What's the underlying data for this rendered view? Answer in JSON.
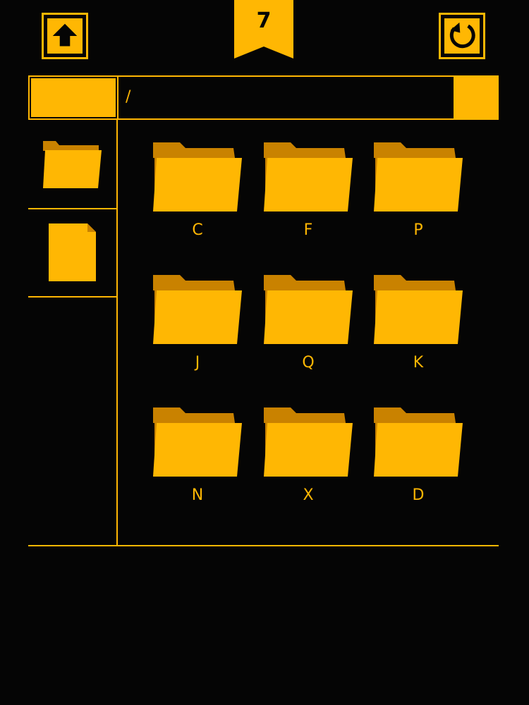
{
  "toolbar": {
    "up_icon": "arrow-up-icon",
    "reload_icon": "refresh-icon",
    "level": "7"
  },
  "path_bar": {
    "path": "/"
  },
  "sidebar": {
    "tools": [
      {
        "icon": "folder-icon"
      },
      {
        "icon": "file-icon"
      }
    ]
  },
  "folders": [
    {
      "label": "C"
    },
    {
      "label": "F"
    },
    {
      "label": "P"
    },
    {
      "label": "J"
    },
    {
      "label": "Q"
    },
    {
      "label": "K"
    },
    {
      "label": "N"
    },
    {
      "label": "X"
    },
    {
      "label": "D"
    }
  ],
  "colors": {
    "accent": "#FFB703",
    "accent_dark": "#C98200",
    "background": "#050505"
  }
}
